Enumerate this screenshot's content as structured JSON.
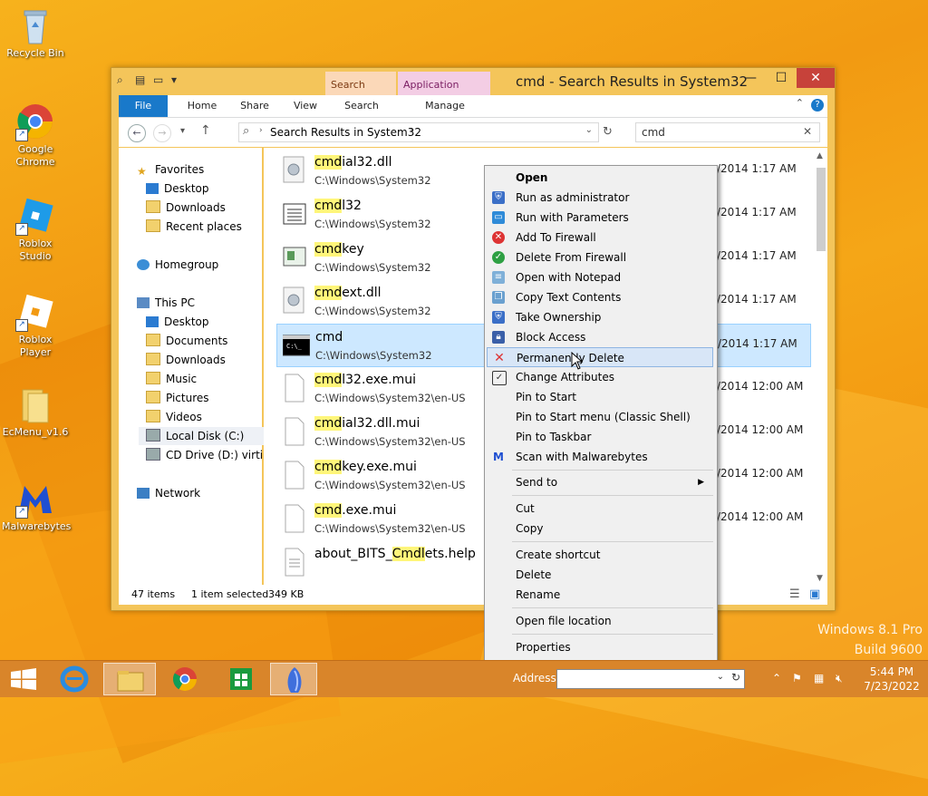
{
  "desktop": {
    "icons": [
      {
        "label": "Recycle Bin"
      },
      {
        "label": "Google Chrome"
      },
      {
        "label": "Roblox Studio"
      },
      {
        "label": "Roblox Player"
      },
      {
        "label": "EcMenu_v1.6"
      },
      {
        "label": "Malwarebytes"
      }
    ]
  },
  "window": {
    "title": "cmd - Search Results in System32",
    "context_tab_search": "Search Tools",
    "context_tab_app": "Application Tools",
    "ribbon_tabs": [
      "File",
      "Home",
      "Share",
      "View",
      "Search",
      "Manage"
    ],
    "address": "Search Results in System32",
    "search_value": "cmd"
  },
  "nav": {
    "favorites": "Favorites",
    "fav_items": [
      "Desktop",
      "Downloads",
      "Recent places"
    ],
    "homegroup": "Homegroup",
    "thispc": "This PC",
    "pc_items": [
      "Desktop",
      "Documents",
      "Downloads",
      "Music",
      "Pictures",
      "Videos",
      "Local Disk (C:)",
      "CD Drive (D:) virtio-w"
    ],
    "network": "Network"
  },
  "files": [
    {
      "hl": "cmd",
      "rest": "ial32.dll",
      "path": "C:\\Windows\\System32",
      "date": "/2014 1:17 AM"
    },
    {
      "hl": "cmd",
      "rest": "l32",
      "path": "C:\\Windows\\System32",
      "date": "/2014 1:17 AM"
    },
    {
      "hl": "cmd",
      "rest": "key",
      "path": "C:\\Windows\\System32",
      "date": "/2014 1:17 AM"
    },
    {
      "hl": "cmd",
      "rest": "ext.dll",
      "path": "C:\\Windows\\System32",
      "date": "/2014 1:17 AM"
    },
    {
      "hl": "",
      "rest": "cmd",
      "path": "C:\\Windows\\System32",
      "date": "/2014 1:17 AM"
    },
    {
      "hl": "cmd",
      "rest": "l32.exe.mui",
      "path": "C:\\Windows\\System32\\en-US",
      "date": "/2014 12:00 AM"
    },
    {
      "hl": "cmd",
      "rest": "ial32.dll.mui",
      "path": "C:\\Windows\\System32\\en-US",
      "date": "/2014 12:00 AM"
    },
    {
      "hl": "cmd",
      "rest": "key.exe.mui",
      "path": "C:\\Windows\\System32\\en-US",
      "date": "/2014 12:00 AM"
    },
    {
      "hl": "cmd",
      "rest": ".exe.mui",
      "path": "C:\\Windows\\System32\\en-US",
      "date": "/2014 12:00 AM"
    },
    {
      "pre": "about_BITS_",
      "hl": "Cmdl",
      "rest": "ets.help",
      "path": "",
      "date": ""
    }
  ],
  "status": {
    "count": "47 items",
    "selected": "1 item selected",
    "size": "349 KB"
  },
  "menu": {
    "items": [
      "Open",
      "Run as administrator",
      "Run with Parameters",
      "Add To Firewall",
      "Delete From Firewall",
      "Open with Notepad",
      "Copy Text Contents",
      "Take Ownership",
      "Block Access",
      "Permanently Delete",
      "Change Attributes",
      "Pin to Start",
      "Pin to Start menu (Classic Shell)",
      "Pin to Taskbar",
      "Scan with Malwarebytes",
      "Send to",
      "Cut",
      "Copy",
      "Create shortcut",
      "Delete",
      "Rename",
      "Open file location",
      "Properties"
    ]
  },
  "taskbar": {
    "address_label": "Address",
    "time": "5:44 PM",
    "date": "7/23/2022"
  },
  "watermark": {
    "line1": "Windows 8.1 Pro",
    "line2": "Build 9600"
  },
  "colors": {
    "accent": "#1979ca",
    "selection": "#cde8ff",
    "highlight": "#fff67a",
    "close": "#c7423a"
  }
}
